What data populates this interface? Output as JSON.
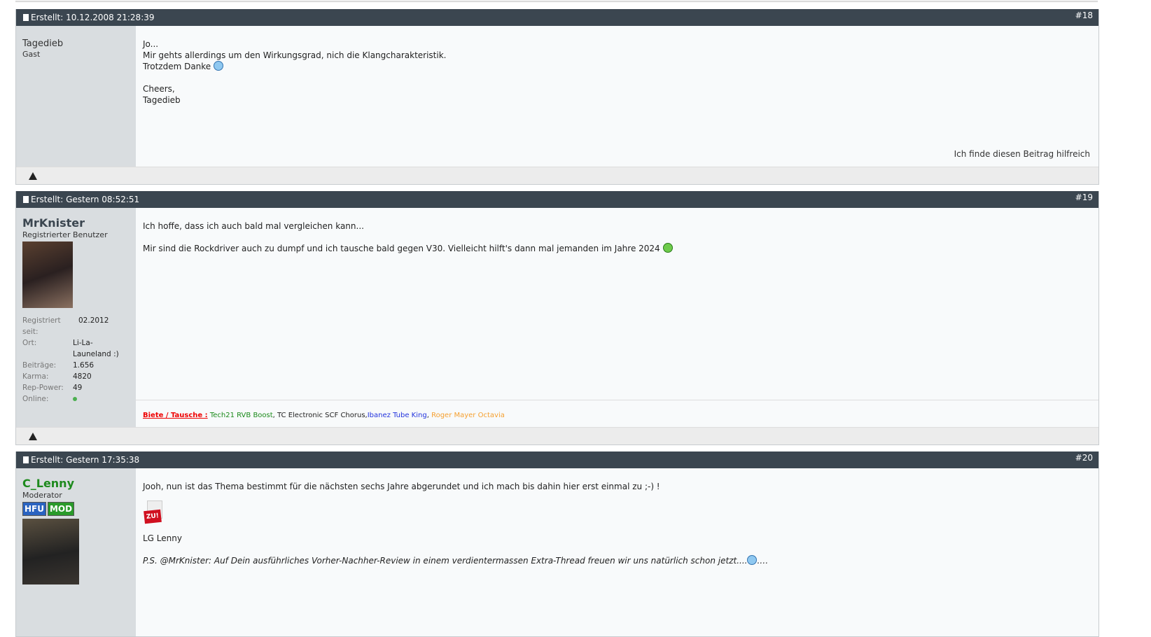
{
  "posts": [
    {
      "number": "#18",
      "created": "Erstellt: 10.12.2008 21:28:39",
      "user": "Tagedieb",
      "role": "Gast",
      "lines": [
        "Jo...",
        "Mir gehts allerdings um den Wirkungsgrad, nich die Klangcharakteristik.",
        "Trotzdem Danke",
        "",
        "Cheers,",
        "Tagedieb"
      ],
      "helpful": "Ich finde diesen Beitrag hilfreich"
    },
    {
      "number": "#19",
      "created": "Erstellt: Gestern 08:52:51",
      "user": "MrKnister",
      "role": "Registrierter Benutzer",
      "info": [
        {
          "k": "Registriert seit:",
          "v": "02.2012"
        },
        {
          "k": "Ort:",
          "v": "Li-La-Launeland :)"
        },
        {
          "k": "Beiträge:",
          "v": "1.656"
        },
        {
          "k": "Karma:",
          "v": "4820"
        },
        {
          "k": "Rep-Power:",
          "v": "49"
        },
        {
          "k": "Online:",
          "v": ""
        }
      ],
      "lines": [
        "Ich hoffe, dass ich auch bald mal vergleichen kann...",
        "Mir sind die Rockdriver auch zu dumpf und ich tausche bald gegen V30. Vielleicht hilft's dann mal jemanden im Jahre 2024"
      ],
      "signature": {
        "label": "Biete / Tausche :",
        "item1": "Tech21 RVB Boost",
        "item2": "TC Electronic SCF Chorus",
        "item3": "Ibanez Tube King",
        "item4": "Roger Mayer Octavia"
      }
    },
    {
      "number": "#20",
      "created": "Erstellt: Gestern 17:35:38",
      "user": "C_Lenny",
      "role": "Moderator",
      "badge1": "HFU",
      "badge2": "MOD",
      "zu": "ZU!",
      "lines": [
        "Jooh, nun ist das Thema bestimmt für die nächsten sechs Jahre abgerundet und ich mach bis dahin hier erst einmal zu ;-) !",
        "LG Lenny",
        "P.S. @MrKnister: Auf Dein ausführliches Vorher-Nachher-Review in einem verdientermassen Extra-Thread freuen wir uns natürlich schon jetzt....",
        ".…"
      ]
    }
  ],
  "colors": {
    "header": "#3b4650",
    "sidebar": "#d9dde0",
    "online": "#4caf50"
  }
}
